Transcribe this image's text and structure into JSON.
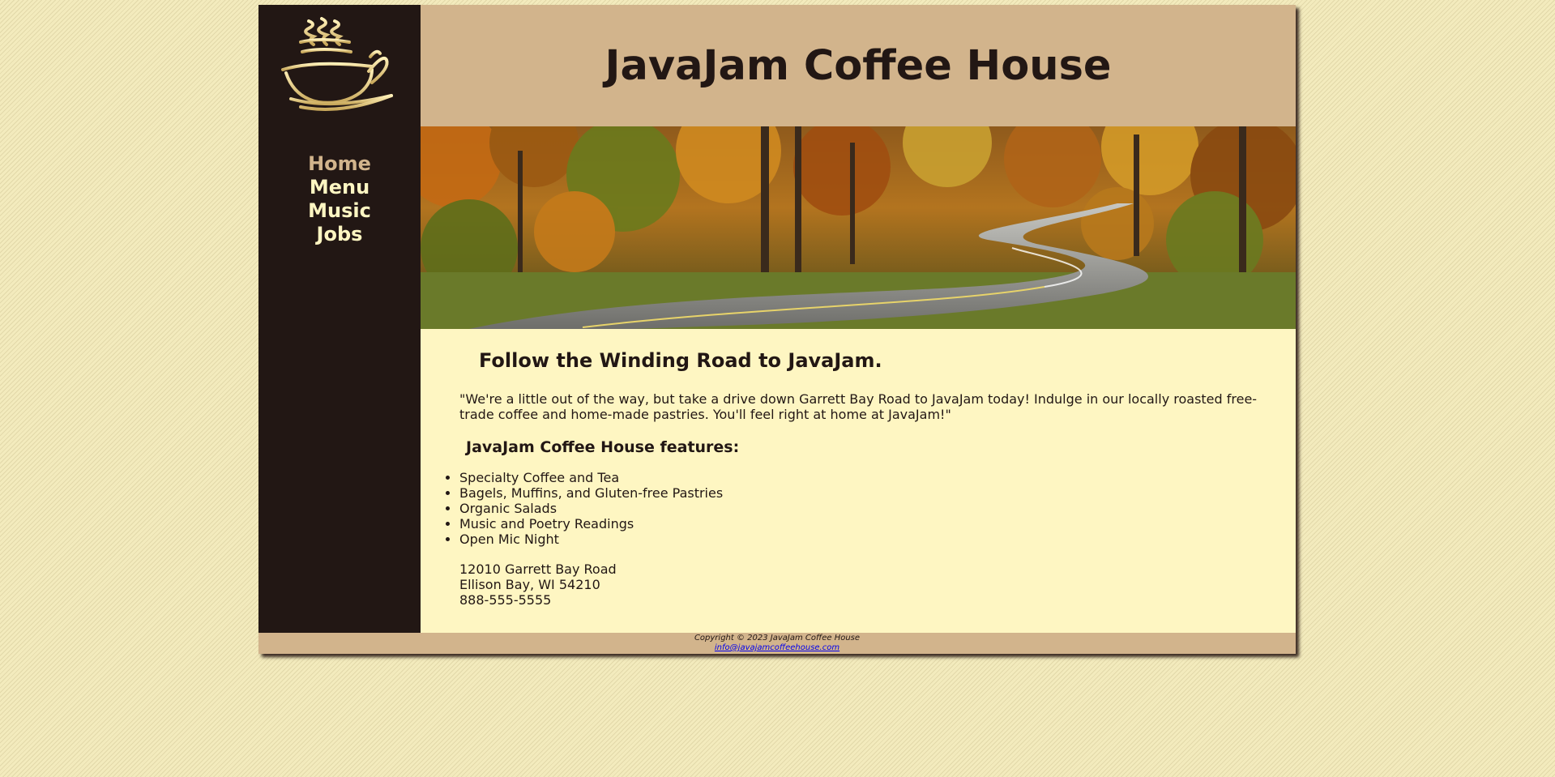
{
  "brand": {
    "title": "JavaJam Coffee House",
    "logo_icon": "coffee-cup-steam-icon"
  },
  "colors": {
    "dark_brown": "#221714",
    "tan": "#d2b48c",
    "cream": "#fef6c2"
  },
  "nav": {
    "items": [
      {
        "label": "Home",
        "active": true
      },
      {
        "label": "Menu",
        "active": false
      },
      {
        "label": "Music",
        "active": false
      },
      {
        "label": "Jobs",
        "active": false
      }
    ]
  },
  "hero": {
    "description": "winding-road-autumn-forest-image"
  },
  "main": {
    "heading": "Follow the Winding Road to JavaJam.",
    "intro": "\"We're a little out of the way, but take a drive down Garrett Bay Road to JavaJam today! Indulge in our locally roasted free-trade coffee and home-made pastries. You'll feel right at home at JavaJam!\"",
    "features_heading": "JavaJam Coffee House features:",
    "features": [
      "Specialty Coffee and Tea",
      "Bagels, Muffins, and Gluten-free Pastries",
      "Organic Salads",
      "Music and Poetry Readings",
      "Open Mic Night"
    ],
    "address": {
      "street": "12010 Garrett Bay Road",
      "city": "Ellison Bay, WI 54210",
      "phone": "888-555-5555"
    }
  },
  "footer": {
    "copyright": "Copyright © 2023 JavaJam Coffee House",
    "email": "info@javajamcoffeehouse.com"
  }
}
